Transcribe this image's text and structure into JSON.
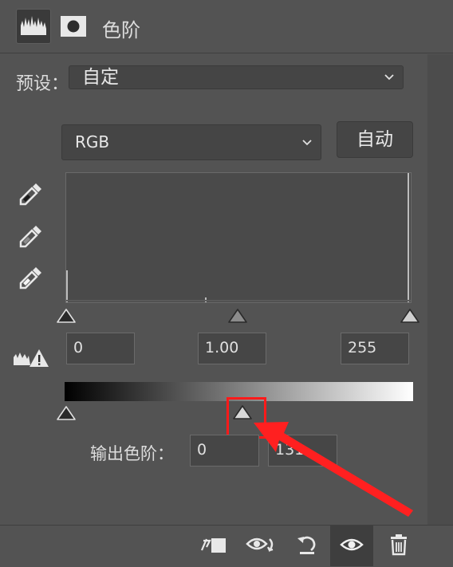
{
  "header": {
    "title": "色阶"
  },
  "preset": {
    "label": "预设：",
    "value": "自定"
  },
  "channel": {
    "value": "RGB"
  },
  "auto_button": {
    "label": "自动"
  },
  "input_levels": {
    "black": "0",
    "gamma": "1.00",
    "white": "255"
  },
  "output_levels": {
    "label": "输出色阶：",
    "black": "0",
    "white": "131"
  },
  "colors": {
    "highlight": "#ff1a1a",
    "arrow": "#ff2020",
    "panel": "#535353"
  },
  "icons": [
    "levels-histogram-icon",
    "mask-icon",
    "eyedropper-black-icon",
    "eyedropper-gray-icon",
    "eyedropper-white-icon",
    "clipping-warning-icon",
    "clip-to-layer-icon",
    "view-previous-icon",
    "reset-icon",
    "visibility-icon",
    "trash-icon"
  ]
}
